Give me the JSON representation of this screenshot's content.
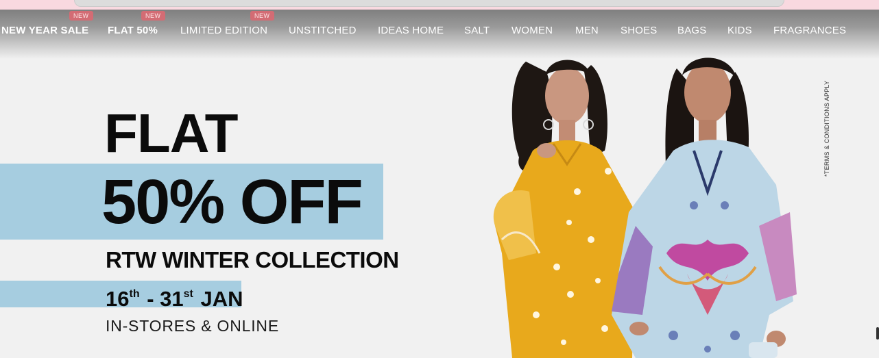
{
  "nav": {
    "items": [
      {
        "label": "NEW YEAR SALE",
        "bold": true,
        "badge": ""
      },
      {
        "label": "FLAT 50%",
        "bold": true,
        "badge": "NEW"
      },
      {
        "label": "LIMITED EDITION",
        "bold": false,
        "badge": "NEW"
      },
      {
        "label": "UNSTITCHED",
        "bold": false,
        "badge": "NEW"
      },
      {
        "label": "IDEAS HOME",
        "bold": false,
        "badge": ""
      },
      {
        "label": "SALT",
        "bold": false,
        "badge": ""
      },
      {
        "label": "WOMEN",
        "bold": false,
        "badge": ""
      },
      {
        "label": "MEN",
        "bold": false,
        "badge": ""
      },
      {
        "label": "SHOES",
        "bold": false,
        "badge": ""
      },
      {
        "label": "BAGS",
        "bold": false,
        "badge": ""
      },
      {
        "label": "KIDS",
        "bold": false,
        "badge": ""
      },
      {
        "label": "FRAGRANCES",
        "bold": false,
        "badge": ""
      }
    ]
  },
  "hero": {
    "flat": "FLAT",
    "offer": "50% OFF",
    "collection": "RTW WINTER COLLECTION",
    "date_start": "16",
    "date_start_suffix": "th",
    "date_sep": " - ",
    "date_end": "31",
    "date_end_suffix": "st",
    "date_month": " JAN",
    "availability": "IN-STORES & ONLINE",
    "terms": "*TERMS & CONDITIONS APPLY"
  },
  "colors": {
    "accent_band": "#a6cde0",
    "badge": "#d36c74",
    "top_strip": "#f9d9e0",
    "dress_yellow": "#e8a91c",
    "dress_blue": "#bcd6e6"
  },
  "icons": {
    "scroll": "scroll-handle"
  }
}
